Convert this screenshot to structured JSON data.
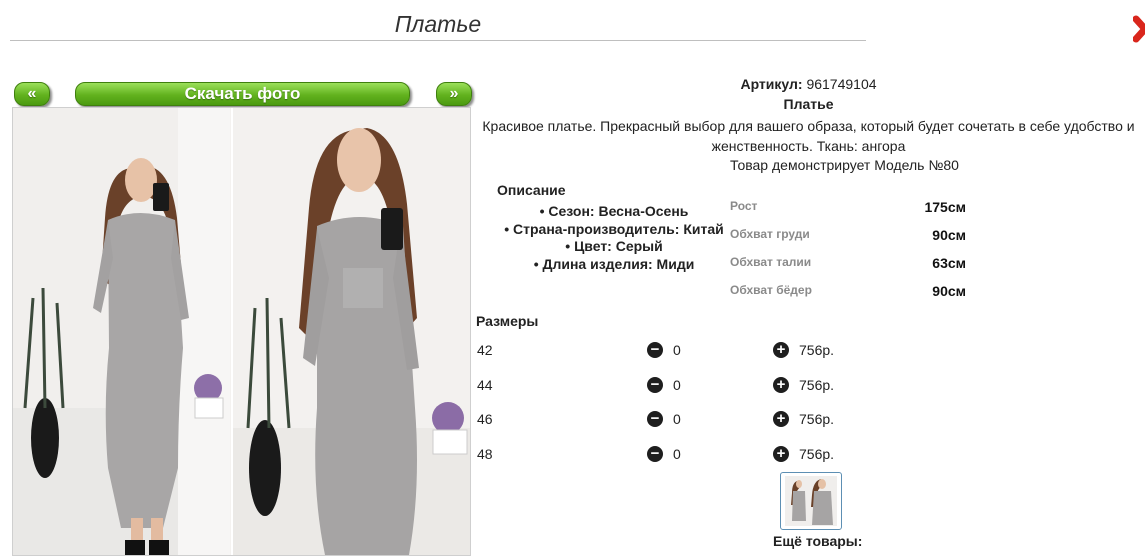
{
  "header": {
    "title": "Платье"
  },
  "gallery": {
    "prev_label": "«",
    "download_label": "Скачать фото",
    "next_label": "»"
  },
  "product": {
    "sku_label": "Артикул:",
    "sku_value": "961749104",
    "name": "Платье",
    "description_line1": "Красивое платье. Прекрасный выбор для вашего образа, который будет сочетать в себе удобство и",
    "description_line2": "женственность. Ткань: ангора",
    "model_note": "Товар демонстрирует Модель №80",
    "description_heading": "Описание",
    "features": [
      "Сезон: Весна-Осень",
      "Страна-производитель: Китай",
      "Цвет: Серый",
      "Длина изделия: Миди"
    ],
    "measurements": [
      {
        "label": "Рост",
        "value": "175см"
      },
      {
        "label": "Обхват груди",
        "value": "90см"
      },
      {
        "label": "Обхват талии",
        "value": "63см"
      },
      {
        "label": "Обхват бёдер",
        "value": "90см"
      }
    ],
    "sizes_heading": "Размеры",
    "sizes": [
      {
        "size": "42",
        "qty": "0",
        "price": "756р."
      },
      {
        "size": "44",
        "qty": "0",
        "price": "756р."
      },
      {
        "size": "46",
        "qty": "0",
        "price": "756р."
      },
      {
        "size": "48",
        "qty": "0",
        "price": "756р."
      }
    ],
    "more_heading": "Ещё товары:"
  },
  "icons": {
    "close": "close-icon",
    "minus": "minus-circle-icon",
    "plus": "plus-circle-icon"
  },
  "colors": {
    "button_green": "#62b21e",
    "close_red": "#d9261c"
  }
}
